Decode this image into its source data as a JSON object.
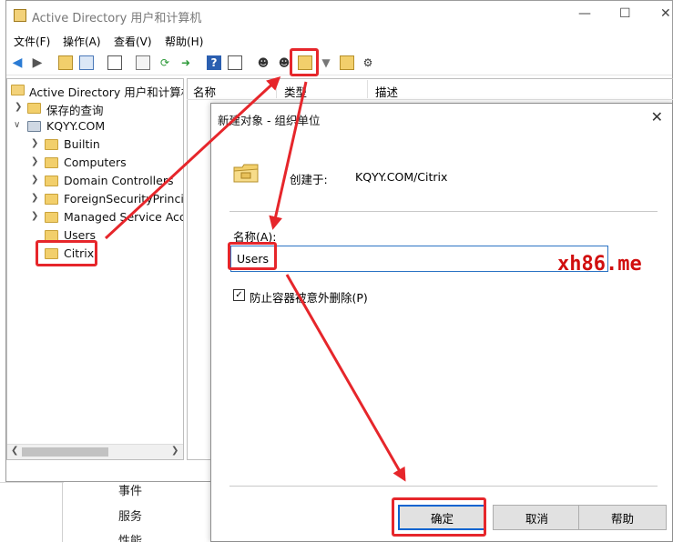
{
  "window": {
    "title": "Active Directory 用户和计算机",
    "minimize": "—",
    "maximize": "☐",
    "close": "✕"
  },
  "menu": [
    "文件(F)",
    "操作(A)",
    "查看(V)",
    "帮助(H)"
  ],
  "tree": {
    "root": "Active Directory 用户和计算机",
    "saved_queries": "保存的查询",
    "domain": "KQYY.COM",
    "children": [
      "Builtin",
      "Computers",
      "Domain Controllers",
      "ForeignSecurityPrincipals",
      "Managed Service Accounts",
      "Users",
      "Citrix"
    ]
  },
  "list_columns": [
    "名称",
    "类型",
    "描述"
  ],
  "dialog": {
    "title": "新建对象 - 组织单位",
    "created_in_label": "创建于:",
    "created_in_value": "KQYY.COM/Citrix",
    "name_label": "名称(A):",
    "name_value": "Users",
    "protect_label": "防止容器被意外删除(P)",
    "protect_checked": true,
    "ok": "确定",
    "cancel": "取消",
    "help": "帮助"
  },
  "background_items": [
    "事件",
    "服务",
    "性能"
  ],
  "watermark": "xh86.me",
  "colors": {
    "annotation": "#e6262b",
    "watermark": "#d10f0f",
    "focus": "#0a64d0"
  }
}
